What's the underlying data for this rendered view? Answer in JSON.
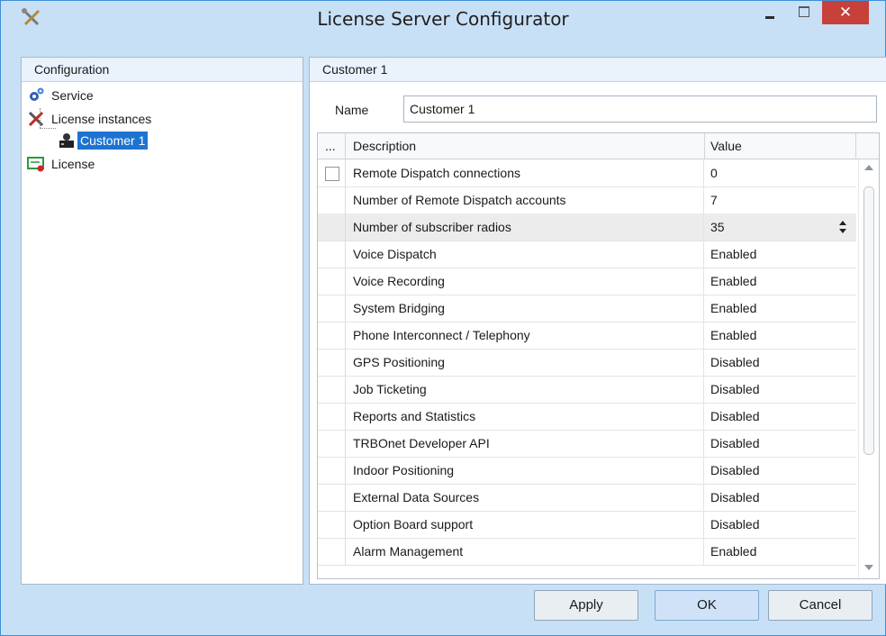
{
  "window": {
    "title": "License Server Configurator",
    "close_glyph": "✕",
    "icons": {
      "app": "tools-icon",
      "minimize": "minimize-icon",
      "maximize": "maximize-icon",
      "close": "close-icon"
    }
  },
  "left_panel": {
    "header": "Configuration",
    "tree": [
      {
        "label": "Service",
        "icon": "gears-icon",
        "level": 0
      },
      {
        "label": "License instances",
        "icon": "wrench-screwdriver-icon",
        "level": 0
      },
      {
        "label": "Customer 1",
        "icon": "server-user-icon",
        "level": 1,
        "selected": true
      },
      {
        "label": "License",
        "icon": "license-certificate-icon",
        "level": 0
      }
    ]
  },
  "right_panel": {
    "header": "Customer 1",
    "name_label": "Name",
    "name_value": "Customer 1",
    "grid": {
      "columns": {
        "select": "...",
        "description": "Description",
        "value": "Value"
      },
      "rows": [
        {
          "description": "Remote Dispatch connections",
          "value": "0",
          "checkbox": true
        },
        {
          "description": "Number of Remote Dispatch accounts",
          "value": "7"
        },
        {
          "description": "Number of subscriber radios",
          "value": "35",
          "editing": true
        },
        {
          "description": "Voice Dispatch",
          "value": "Enabled"
        },
        {
          "description": "Voice Recording",
          "value": "Enabled"
        },
        {
          "description": "System Bridging",
          "value": "Enabled"
        },
        {
          "description": "Phone Interconnect / Telephony",
          "value": "Enabled"
        },
        {
          "description": "GPS Positioning",
          "value": "Disabled"
        },
        {
          "description": "Job Ticketing",
          "value": "Disabled"
        },
        {
          "description": "Reports and Statistics",
          "value": "Disabled"
        },
        {
          "description": "TRBOnet Developer API",
          "value": "Disabled"
        },
        {
          "description": "Indoor Positioning",
          "value": "Disabled"
        },
        {
          "description": "External Data Sources",
          "value": "Disabled"
        },
        {
          "description": "Option Board support",
          "value": "Disabled"
        },
        {
          "description": "Alarm Management",
          "value": "Enabled"
        }
      ]
    }
  },
  "buttons": {
    "apply": "Apply",
    "ok": "OK",
    "cancel": "Cancel"
  },
  "colors": {
    "accent": "#1e73d2",
    "close_button": "#c7403a",
    "window_frame": "#c8e0f6"
  }
}
